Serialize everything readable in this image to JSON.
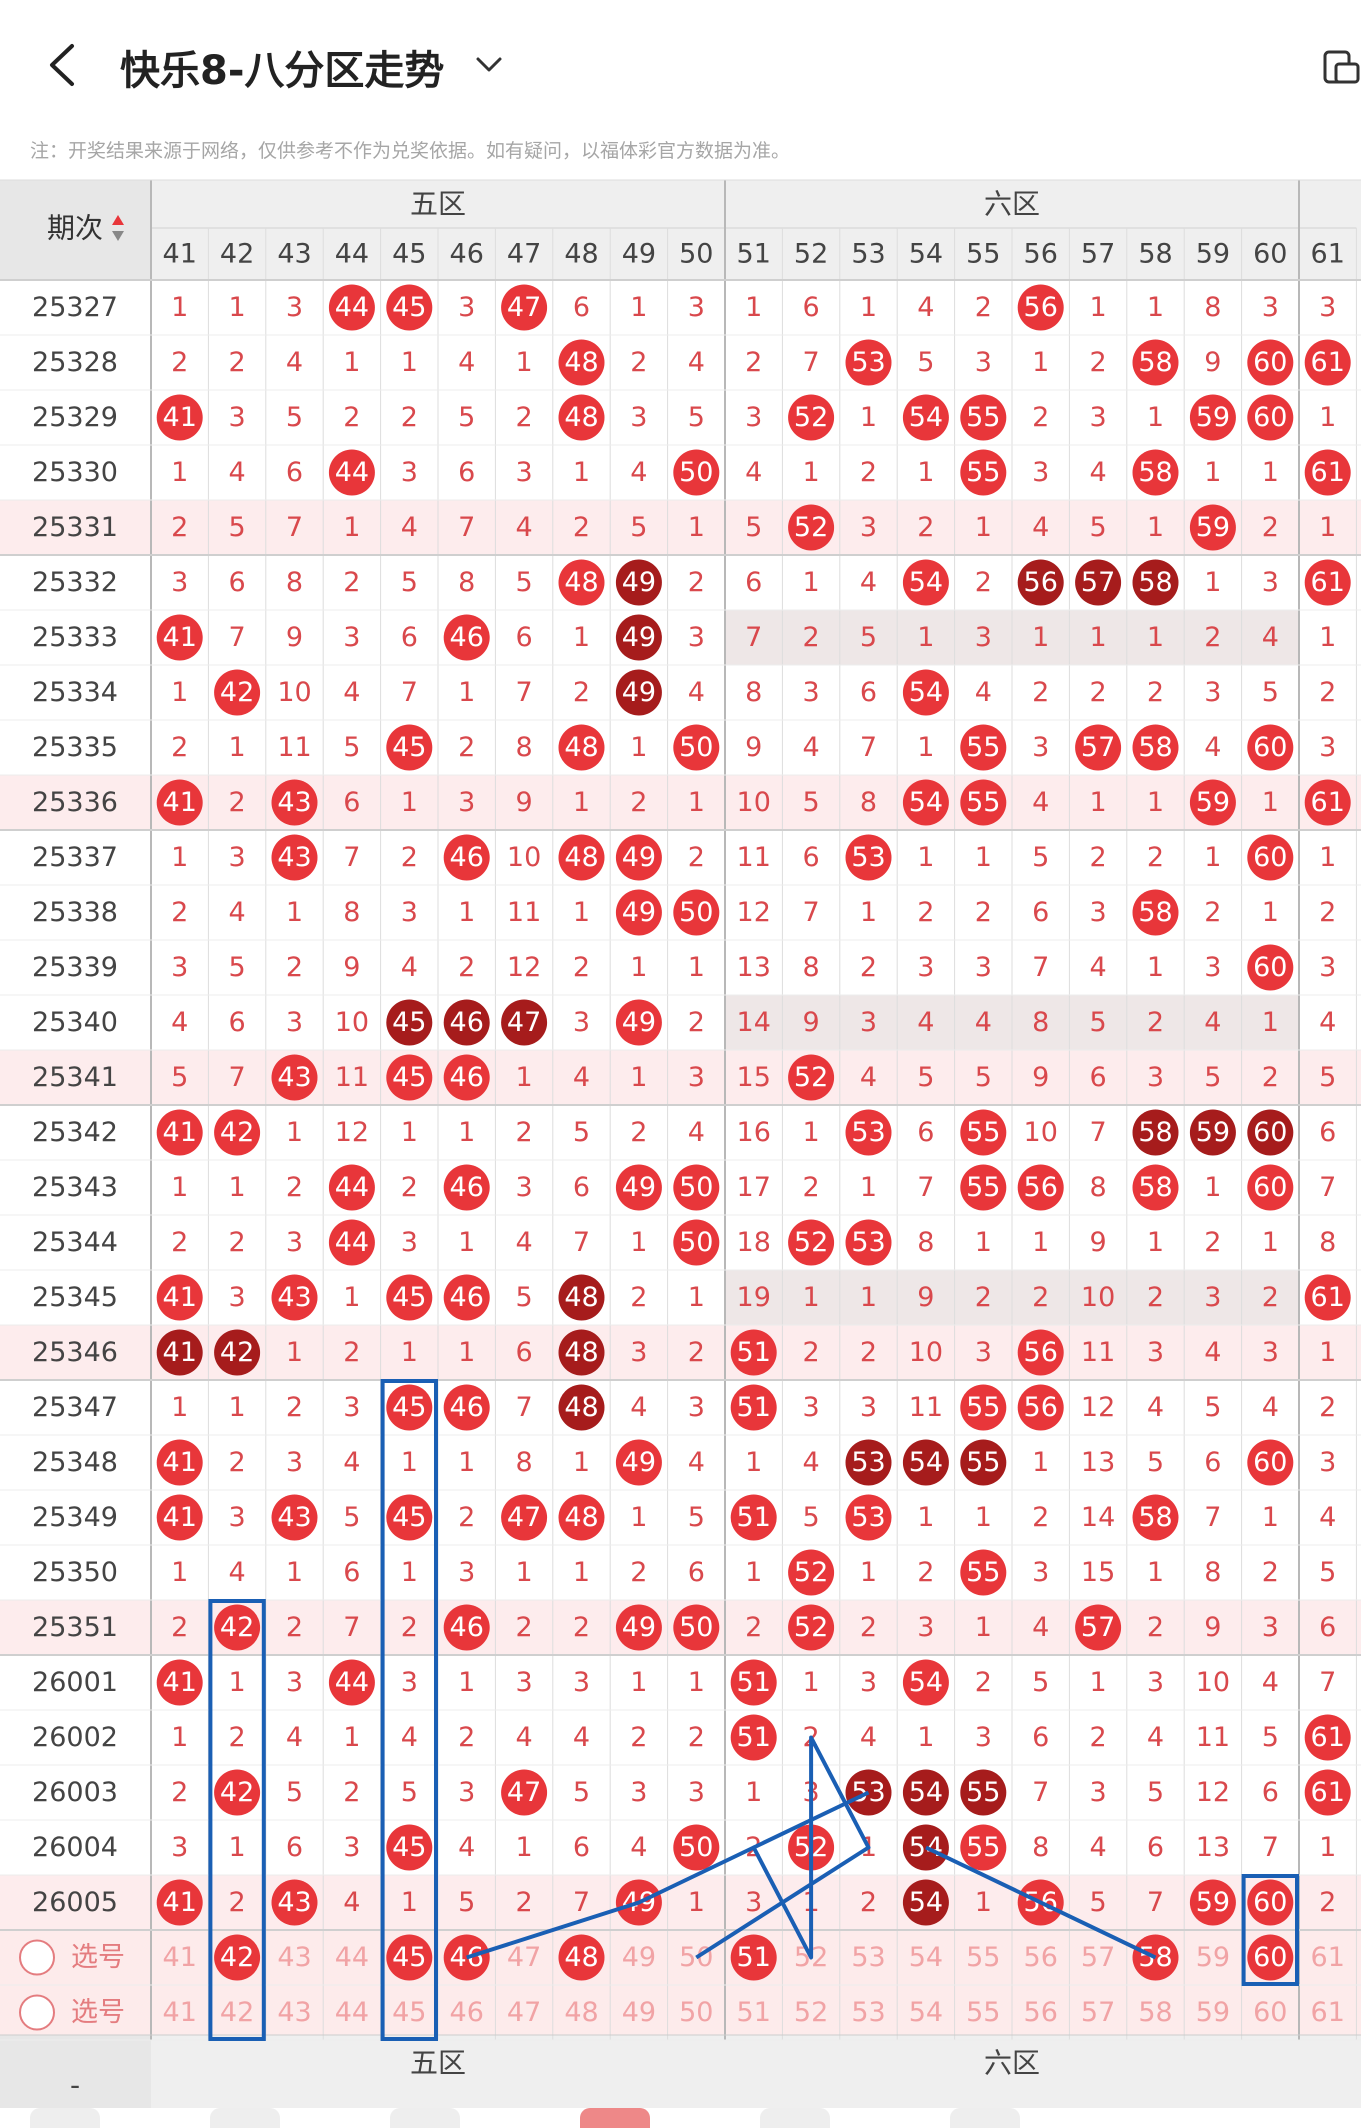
{
  "header": {
    "title": "快乐8-八分区走势"
  },
  "note": "注：开奖结果来源于网络，仅供参考不作为兑奖依据。如有疑问，以福体彩官方数据为准。",
  "table": {
    "period_label": "期次",
    "zones": [
      {
        "label": "五区"
      },
      {
        "label": "六区"
      }
    ],
    "columns": [
      41,
      42,
      43,
      44,
      45,
      46,
      47,
      48,
      49,
      50,
      51,
      52,
      53,
      54,
      55,
      56,
      57,
      58,
      59,
      60,
      61
    ],
    "rows": [
      {
        "period": "25327",
        "values": [
          1,
          1,
          3,
          "44",
          "45",
          3,
          "47",
          6,
          1,
          3,
          1,
          6,
          1,
          4,
          2,
          "56",
          1,
          1,
          8,
          3,
          3
        ]
      },
      {
        "period": "25328",
        "values": [
          2,
          2,
          4,
          1,
          1,
          4,
          1,
          "48",
          2,
          4,
          2,
          7,
          "53",
          5,
          3,
          1,
          2,
          "58",
          9,
          "60",
          "61"
        ]
      },
      {
        "period": "25329",
        "values": [
          "41",
          3,
          5,
          2,
          2,
          5,
          2,
          "48",
          3,
          5,
          3,
          "52",
          1,
          "54",
          "55",
          2,
          3,
          1,
          "59",
          "60",
          1
        ]
      },
      {
        "period": "25330",
        "values": [
          1,
          4,
          6,
          "44",
          3,
          6,
          3,
          1,
          4,
          "50",
          4,
          1,
          2,
          1,
          "55",
          3,
          4,
          "58",
          1,
          1,
          "61"
        ]
      },
      {
        "period": "25331",
        "values": [
          2,
          5,
          7,
          1,
          4,
          7,
          4,
          2,
          5,
          1,
          5,
          "52",
          3,
          2,
          1,
          4,
          5,
          1,
          "59",
          2,
          1
        ]
      },
      {
        "period": "25332",
        "values": [
          3,
          6,
          8,
          2,
          5,
          8,
          5,
          "48",
          "49d",
          2,
          6,
          1,
          4,
          "54",
          2,
          "56d",
          "57d",
          "58d",
          1,
          3,
          "61"
        ]
      },
      {
        "period": "25333",
        "values": [
          "41",
          7,
          9,
          3,
          6,
          "46",
          6,
          1,
          "49d",
          3,
          7,
          2,
          5,
          1,
          3,
          1,
          1,
          1,
          2,
          4,
          1
        ]
      },
      {
        "period": "25334",
        "values": [
          1,
          "42",
          10,
          4,
          7,
          1,
          7,
          2,
          "49d",
          4,
          8,
          3,
          6,
          "54",
          4,
          2,
          2,
          2,
          3,
          5,
          2
        ]
      },
      {
        "period": "25335",
        "values": [
          2,
          1,
          11,
          5,
          "45",
          2,
          8,
          "48",
          1,
          "50",
          9,
          4,
          7,
          1,
          "55",
          3,
          "57",
          "58",
          4,
          "60",
          3
        ]
      },
      {
        "period": "25336",
        "values": [
          "41",
          2,
          "43",
          6,
          1,
          3,
          9,
          1,
          2,
          1,
          10,
          5,
          8,
          "54",
          "55",
          4,
          1,
          1,
          "59",
          1,
          "61"
        ]
      },
      {
        "period": "25337",
        "values": [
          1,
          3,
          "43",
          7,
          2,
          "46",
          10,
          "48",
          "49",
          2,
          11,
          6,
          "53",
          1,
          1,
          5,
          2,
          2,
          1,
          "60",
          1
        ]
      },
      {
        "period": "25338",
        "values": [
          2,
          4,
          1,
          8,
          3,
          1,
          11,
          1,
          "49",
          "50",
          12,
          7,
          1,
          2,
          2,
          6,
          3,
          "58",
          2,
          1,
          2
        ]
      },
      {
        "period": "25339",
        "values": [
          3,
          5,
          2,
          9,
          4,
          2,
          12,
          2,
          1,
          1,
          13,
          8,
          2,
          3,
          3,
          7,
          4,
          1,
          3,
          "60",
          3
        ]
      },
      {
        "period": "25340",
        "values": [
          4,
          6,
          3,
          10,
          "45d",
          "46d",
          "47d",
          3,
          "49",
          2,
          14,
          9,
          3,
          4,
          4,
          8,
          5,
          2,
          4,
          1,
          4
        ]
      },
      {
        "period": "25341",
        "values": [
          5,
          7,
          "43",
          11,
          "45",
          "46",
          1,
          4,
          1,
          3,
          15,
          "52",
          4,
          5,
          5,
          9,
          6,
          3,
          5,
          2,
          5
        ]
      },
      {
        "period": "25342",
        "values": [
          "41",
          "42",
          1,
          12,
          1,
          1,
          2,
          5,
          2,
          4,
          16,
          1,
          "53",
          6,
          "55",
          10,
          7,
          "58d",
          "59d",
          "60d",
          6
        ]
      },
      {
        "period": "25343",
        "values": [
          1,
          1,
          2,
          "44",
          2,
          "46",
          3,
          6,
          "49",
          "50",
          17,
          2,
          1,
          7,
          "55",
          "56",
          8,
          "58",
          1,
          "60",
          7
        ]
      },
      {
        "period": "25344",
        "values": [
          2,
          2,
          3,
          "44",
          3,
          1,
          4,
          7,
          1,
          "50",
          18,
          "52",
          "53",
          8,
          1,
          1,
          9,
          1,
          2,
          1,
          8
        ]
      },
      {
        "period": "25345",
        "values": [
          "41",
          3,
          "43",
          1,
          "45",
          "46",
          5,
          "48d",
          2,
          1,
          19,
          1,
          1,
          9,
          2,
          2,
          10,
          2,
          3,
          2,
          "61"
        ]
      },
      {
        "period": "25346",
        "values": [
          "41d",
          "42d",
          1,
          2,
          1,
          1,
          6,
          "48d",
          3,
          2,
          "51",
          2,
          2,
          10,
          3,
          "56",
          11,
          3,
          4,
          3,
          1
        ]
      },
      {
        "period": "25347",
        "values": [
          1,
          1,
          2,
          3,
          "45",
          "46",
          7,
          "48d",
          4,
          3,
          "51",
          3,
          3,
          11,
          "55",
          "56",
          12,
          4,
          5,
          4,
          2
        ]
      },
      {
        "period": "25348",
        "values": [
          "41",
          2,
          3,
          4,
          1,
          1,
          8,
          1,
          "49",
          4,
          1,
          4,
          "53d",
          "54d",
          "55d",
          1,
          13,
          5,
          6,
          "60",
          3
        ]
      },
      {
        "period": "25349",
        "values": [
          "41",
          3,
          "43",
          5,
          "45",
          2,
          "47",
          "48",
          1,
          5,
          "51",
          5,
          "53",
          1,
          1,
          2,
          14,
          "58",
          7,
          1,
          4
        ]
      },
      {
        "period": "25350",
        "values": [
          1,
          4,
          1,
          6,
          1,
          3,
          1,
          1,
          2,
          6,
          1,
          "52",
          1,
          2,
          "55",
          3,
          15,
          1,
          8,
          2,
          5
        ]
      },
      {
        "period": "25351",
        "values": [
          2,
          "42",
          2,
          7,
          2,
          "46",
          2,
          2,
          "49",
          "50",
          2,
          "52",
          2,
          3,
          1,
          4,
          "57",
          2,
          9,
          3,
          6
        ]
      },
      {
        "period": "26001",
        "values": [
          "41",
          1,
          3,
          "44",
          3,
          1,
          3,
          3,
          1,
          1,
          "51",
          1,
          3,
          "54",
          2,
          5,
          1,
          3,
          10,
          4,
          7
        ]
      },
      {
        "period": "26002",
        "values": [
          1,
          2,
          4,
          1,
          4,
          2,
          4,
          4,
          2,
          2,
          "51",
          2,
          4,
          1,
          3,
          6,
          2,
          4,
          11,
          5,
          "61"
        ]
      },
      {
        "period": "26003",
        "values": [
          2,
          "42",
          5,
          2,
          5,
          3,
          "47",
          5,
          3,
          3,
          1,
          3,
          "53d",
          "54d",
          "55d",
          7,
          3,
          5,
          12,
          6,
          "61"
        ]
      },
      {
        "period": "26004",
        "values": [
          3,
          1,
          6,
          3,
          "45",
          4,
          1,
          6,
          4,
          "50",
          2,
          "52",
          1,
          "54d",
          "55",
          8,
          4,
          6,
          13,
          7,
          1
        ]
      },
      {
        "period": "26005",
        "values": [
          "41",
          2,
          "43",
          4,
          1,
          5,
          2,
          7,
          "49",
          1,
          3,
          1,
          2,
          "54d",
          1,
          "56",
          5,
          7,
          "59",
          "60",
          2
        ]
      }
    ],
    "select_rows": [
      {
        "label": "选号",
        "selected": [
          42,
          45,
          46,
          48,
          51,
          58,
          60
        ]
      },
      {
        "label": "选号",
        "selected": []
      }
    ]
  },
  "colors": {
    "ball_red": "#e8363a",
    "ball_dark": "#a61c1c",
    "number_text": "#d9484c",
    "annotation_blue": "#1a5fb4"
  }
}
